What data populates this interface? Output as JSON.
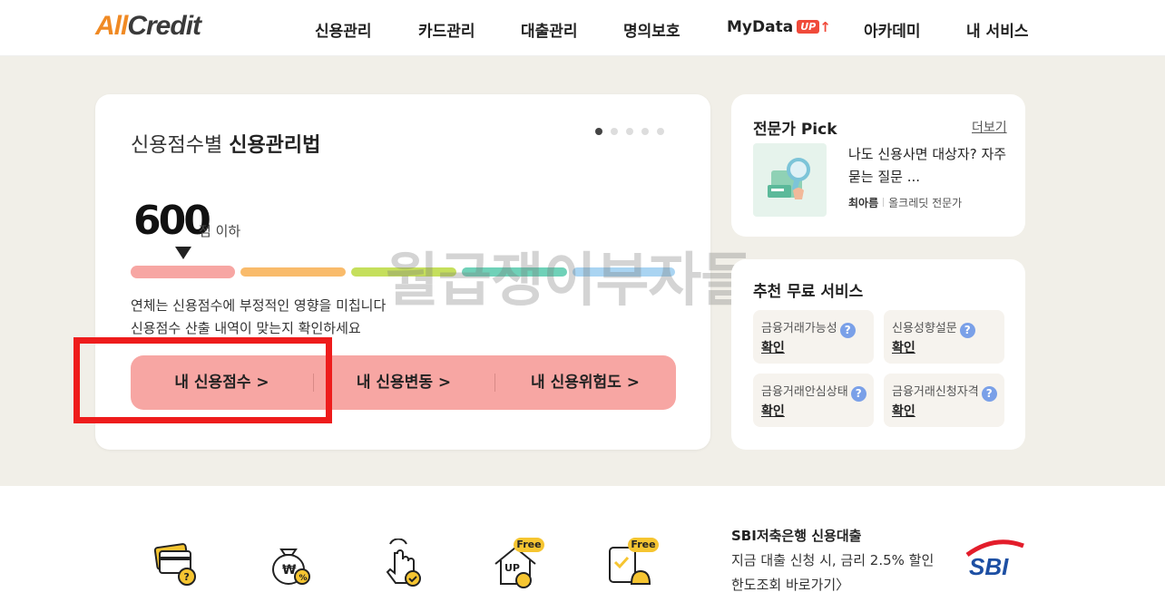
{
  "header": {
    "logo_all": "All",
    "logo_credit": "Credit",
    "nav": [
      "신용관리",
      "카드관리",
      "대출관리",
      "명의보호",
      "MyData",
      "아카데미",
      "내 서비스"
    ],
    "mydata_badge": "UP"
  },
  "main_card": {
    "title_light": "신용점수별 ",
    "title_bold": "신용관리법",
    "slide_count": 5,
    "active_slide": 1,
    "score": "600",
    "score_suffix": "점 이하",
    "desc_line1": "연체는 신용점수에 부정적인 영향을 미칩니다",
    "desc_line2": "신용점수 산출 내역이 맞는지 확인하세요",
    "buttons": [
      "내 신용점수 >",
      "내 신용변동 >",
      "내 신용위험도 >"
    ],
    "segment_colors": [
      "#f7a6a3",
      "#f9bb6b",
      "#c5df5c",
      "#6fd1b8",
      "#a9d4f2"
    ]
  },
  "watermark": "월급쟁이부자들",
  "expert_pick": {
    "title": "전문가 Pick",
    "more": "더보기",
    "article": "나도 신용사면 대상자? 자주 묻는 질문 ...",
    "author_name": "최아름",
    "author_role": "올크레딧 전문가"
  },
  "free_services": {
    "title": "추천 무료 서비스",
    "items": [
      {
        "label": "금융거래가능성",
        "link": "확인"
      },
      {
        "label": "신용성향설문",
        "link": "확인"
      },
      {
        "label": "금융거래안심상태",
        "link": "확인"
      },
      {
        "label": "금융거래신청자격",
        "link": "확인"
      }
    ],
    "help_glyph": "?"
  },
  "bottom": {
    "free_badge": "Free",
    "up_text": "UP",
    "promo_title": "SBI저축은행 신용대출",
    "promo_line": "지금 대출 신청 시, 금리 2.5% 할인",
    "promo_link": "한도조회 바로가기〉",
    "sbi_logo": "SBI"
  },
  "colors": {
    "accent_orange": "#f08a24",
    "button_pink": "#f7a6a3",
    "highlight_red": "#ee1c1c",
    "band_beige": "#f1efe8"
  }
}
